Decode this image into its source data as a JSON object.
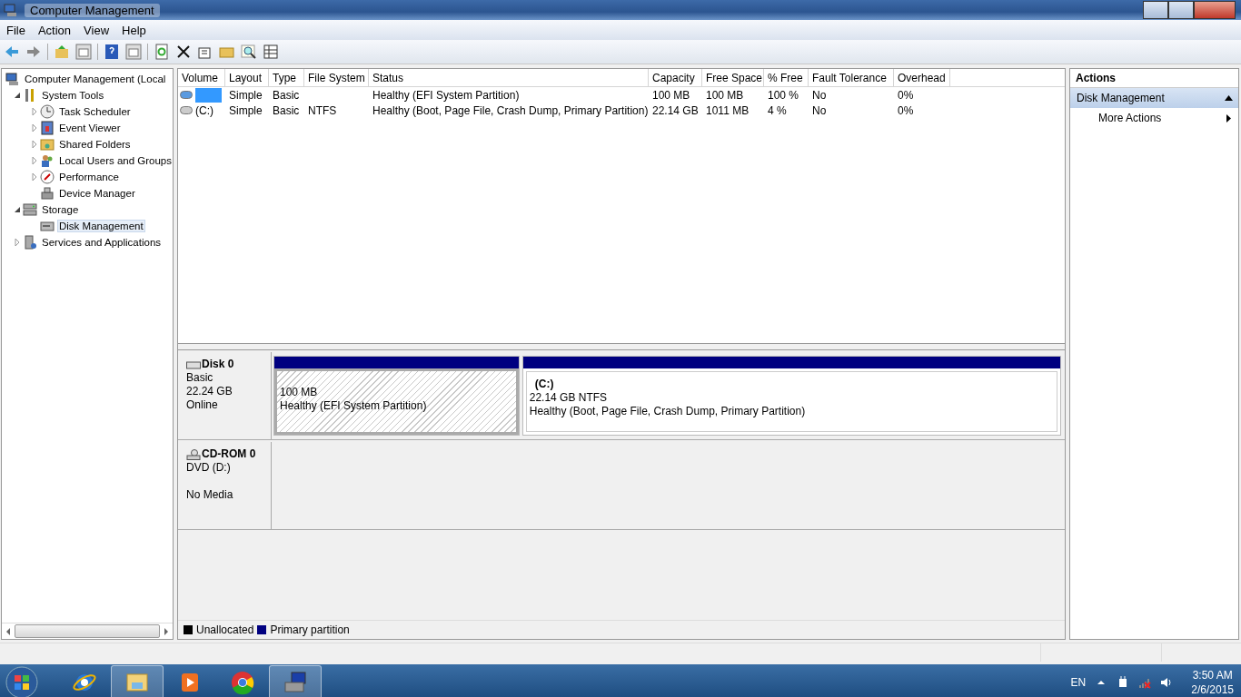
{
  "window": {
    "title": "Computer Management"
  },
  "menu": [
    "File",
    "Action",
    "View",
    "Help"
  ],
  "tree": [
    {
      "label": "Computer Management (Local",
      "selected": false,
      "children": [
        {
          "label": "System Tools",
          "expanded": true,
          "selected": false,
          "children": [
            {
              "label": "Task Scheduler",
              "expanded": false,
              "selected": false
            },
            {
              "label": "Event Viewer",
              "expanded": false,
              "selected": false
            },
            {
              "label": "Shared Folders",
              "expanded": false,
              "selected": false
            },
            {
              "label": "Local Users and Groups",
              "expanded": false,
              "selected": false
            },
            {
              "label": "Performance",
              "expanded": false,
              "selected": false
            },
            {
              "label": "Device Manager",
              "selected": false
            }
          ]
        },
        {
          "label": "Storage",
          "expanded": true,
          "selected": false,
          "children": [
            {
              "label": "Disk Management",
              "selected": true
            }
          ]
        },
        {
          "label": "Services and Applications",
          "expanded": false,
          "selected": false
        }
      ]
    }
  ],
  "volumes": {
    "columns": [
      "Volume",
      "Layout",
      "Type",
      "File System",
      "Status",
      "Capacity",
      "Free Space",
      "% Free",
      "Fault Tolerance",
      "Overhead"
    ],
    "rows": [
      {
        "selected": true,
        "cells": [
          null,
          "Simple",
          "Basic",
          null,
          "Healthy (EFI System Partition)",
          "100 MB",
          "100 MB",
          "100 %",
          "No",
          "0%"
        ]
      },
      {
        "selected": false,
        "cells": [
          "(C:)",
          "Simple",
          "Basic",
          "NTFS",
          "Healthy (Boot, Page File, Crash Dump, Primary Partition)",
          "22.14 GB",
          "1011 MB",
          "4 %",
          "No",
          "0%"
        ]
      }
    ]
  },
  "disks": [
    {
      "kind": "disk",
      "name": "Disk 0",
      "lines": [
        "Basic",
        "22.24 GB",
        "Online"
      ],
      "partitions": [
        {
          "selected": true,
          "size": "100 MB",
          "status": "Healthy (EFI System Partition)"
        },
        {
          "selected": false,
          "label": "(C:)",
          "size": "22.14 GB NTFS",
          "status": "Healthy (Boot, Page File, Crash Dump, Primary Partition)"
        }
      ]
    },
    {
      "kind": "cdrom",
      "name": "CD-ROM 0",
      "lines": [
        "DVD (D:)",
        "No Media"
      ]
    }
  ],
  "legend": [
    {
      "label": "Unallocated",
      "color": "#000000"
    },
    {
      "label": "Primary partition",
      "color": "#000080"
    }
  ],
  "actions": {
    "title": "Actions",
    "sections": [
      {
        "label": "Disk Management",
        "expanded": true,
        "items": [
          "More Actions"
        ]
      }
    ]
  },
  "taskbar": {
    "apps": [
      {
        "kind": "ie",
        "running": false
      },
      {
        "kind": "explorer",
        "running": true
      },
      {
        "kind": "media",
        "running": false
      },
      {
        "kind": "chrome",
        "running": false
      },
      {
        "kind": "compmgmt",
        "running": true
      }
    ],
    "language": "EN",
    "time": "3:50 AM",
    "date": "2/6/2015"
  }
}
